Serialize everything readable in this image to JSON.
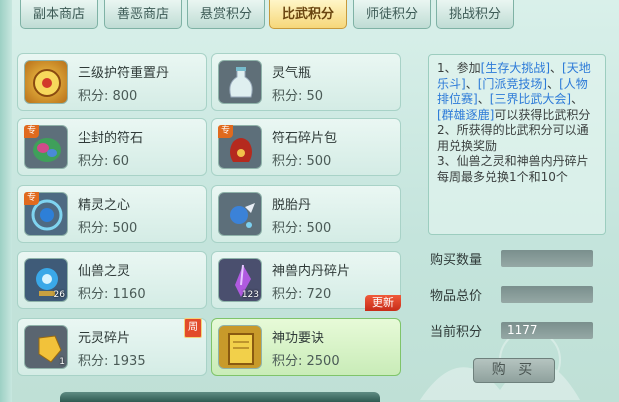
{
  "tabs": [
    {
      "label": "副本商店",
      "active": false
    },
    {
      "label": "善恶商店",
      "active": false
    },
    {
      "label": "悬赏积分",
      "active": false
    },
    {
      "label": "比武积分",
      "active": true
    },
    {
      "label": "师徒积分",
      "active": false
    },
    {
      "label": "挑战积分",
      "active": false
    }
  ],
  "items": [
    {
      "name": "三级护符重置丹",
      "price": "积分: 800",
      "icon": "amulet-reset-pill-icon"
    },
    {
      "name": "灵气瓶",
      "price": "积分: 50",
      "icon": "spirit-bottle-icon"
    },
    {
      "name": "尘封的符石",
      "price": "积分: 60",
      "icon": "sealed-rune-stone-icon",
      "tag": "专"
    },
    {
      "name": "符石碎片包",
      "price": "积分: 500",
      "icon": "rune-fragment-bag-icon",
      "tag": "专"
    },
    {
      "name": "精灵之心",
      "price": "积分: 500",
      "icon": "spirit-heart-icon",
      "tag": "专"
    },
    {
      "name": "脱胎丹",
      "price": "积分: 500",
      "icon": "rebirth-pill-icon"
    },
    {
      "name": "仙兽之灵",
      "price": "积分: 1160",
      "icon": "immortal-beast-spirit-icon",
      "count": "26"
    },
    {
      "name": "神兽内丹碎片",
      "price": "积分: 720",
      "icon": "divine-beast-core-fragment-icon",
      "count": "123",
      "badge": "更新"
    },
    {
      "name": "元灵碎片",
      "price": "积分: 1935",
      "icon": "yuanling-fragment-icon",
      "count": "1",
      "badge": "周"
    },
    {
      "name": "神功要诀",
      "price": "积分: 2500",
      "icon": "martial-manual-icon"
    }
  ],
  "info": {
    "p1_a": "1、参加",
    "p1_l1": "[生存大挑战]",
    "p1_b": "、",
    "p1_l2": "[天地乐斗]",
    "p1_c": "、",
    "p1_l3": "[门派竞技场]",
    "p1_d": "、",
    "p1_l4": "[人物排位赛]",
    "p1_e": "、",
    "p1_l5": "[三界比武大会]",
    "p1_f": "、",
    "p1_l6": "[群雄逐鹿]",
    "p1_g": "可以获得比武积分",
    "p2": "2、所获得的比武积分可以通用兑换奖励",
    "p3": "3、仙兽之灵和神兽内丹碎片每周最多兑换1个和10个"
  },
  "form": {
    "qty_label": "购买数量",
    "qty_value": "",
    "total_label": "物品总价",
    "total_value": "",
    "current_label": "当前积分",
    "current_value": "1177"
  },
  "buy_label": "购 买",
  "colors": {
    "accent_tab": "#f6d77a",
    "link": "#2c7ad8",
    "badge_red": "#e24b2a"
  }
}
